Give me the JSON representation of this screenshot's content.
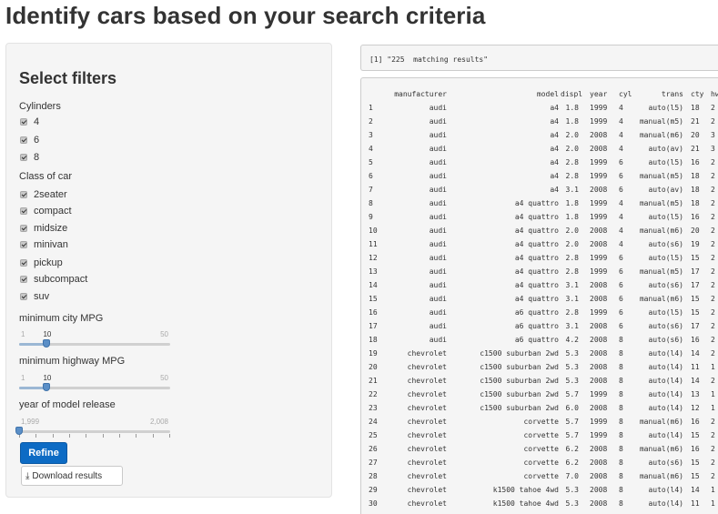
{
  "page": {
    "title": "Identify cars based on your search criteria"
  },
  "sidebar": {
    "heading": "Select filters",
    "cylinders": {
      "label": "Cylinders",
      "options": [
        {
          "label": "4",
          "checked": true
        },
        {
          "label": "6",
          "checked": true
        },
        {
          "label": "8",
          "checked": true
        }
      ]
    },
    "class": {
      "label": "Class of car",
      "options": [
        {
          "label": "2seater",
          "checked": true
        },
        {
          "label": "compact",
          "checked": true
        },
        {
          "label": "midsize",
          "checked": true
        },
        {
          "label": "minivan",
          "checked": true
        },
        {
          "label": "pickup",
          "checked": true
        },
        {
          "label": "subcompact",
          "checked": true
        },
        {
          "label": "suv",
          "checked": true
        }
      ]
    },
    "city_mpg": {
      "label": "minimum city MPG",
      "min": "1",
      "max": "50",
      "value_label": "10",
      "value": 10,
      "range": [
        1,
        50
      ]
    },
    "hwy_mpg": {
      "label": "minimum highway MPG",
      "min": "1",
      "max": "50",
      "value_label": "10",
      "value": 10,
      "range": [
        1,
        50
      ]
    },
    "year": {
      "label": "year of model release",
      "min": "1,999",
      "max": "2,008",
      "value": 1999,
      "range": [
        1999,
        2008
      ]
    },
    "refine_label": "Refine",
    "download_label": "Download results",
    "download_icon": "download-icon"
  },
  "output": {
    "count_text": "[1] \"225  matching results\"",
    "columns": [
      "",
      "manufacturer",
      "model",
      "displ",
      "year",
      "cyl",
      "trans",
      "cty",
      "hw"
    ],
    "rows": [
      [
        "1",
        "audi",
        "a4",
        "1.8",
        "1999",
        "4",
        "auto(l5)",
        "18",
        "2"
      ],
      [
        "2",
        "audi",
        "a4",
        "1.8",
        "1999",
        "4",
        "manual(m5)",
        "21",
        "2"
      ],
      [
        "3",
        "audi",
        "a4",
        "2.0",
        "2008",
        "4",
        "manual(m6)",
        "20",
        "3"
      ],
      [
        "4",
        "audi",
        "a4",
        "2.0",
        "2008",
        "4",
        "auto(av)",
        "21",
        "3"
      ],
      [
        "5",
        "audi",
        "a4",
        "2.8",
        "1999",
        "6",
        "auto(l5)",
        "16",
        "2"
      ],
      [
        "6",
        "audi",
        "a4",
        "2.8",
        "1999",
        "6",
        "manual(m5)",
        "18",
        "2"
      ],
      [
        "7",
        "audi",
        "a4",
        "3.1",
        "2008",
        "6",
        "auto(av)",
        "18",
        "2"
      ],
      [
        "8",
        "audi",
        "a4 quattro",
        "1.8",
        "1999",
        "4",
        "manual(m5)",
        "18",
        "2"
      ],
      [
        "9",
        "audi",
        "a4 quattro",
        "1.8",
        "1999",
        "4",
        "auto(l5)",
        "16",
        "2"
      ],
      [
        "10",
        "audi",
        "a4 quattro",
        "2.0",
        "2008",
        "4",
        "manual(m6)",
        "20",
        "2"
      ],
      [
        "11",
        "audi",
        "a4 quattro",
        "2.0",
        "2008",
        "4",
        "auto(s6)",
        "19",
        "2"
      ],
      [
        "12",
        "audi",
        "a4 quattro",
        "2.8",
        "1999",
        "6",
        "auto(l5)",
        "15",
        "2"
      ],
      [
        "13",
        "audi",
        "a4 quattro",
        "2.8",
        "1999",
        "6",
        "manual(m5)",
        "17",
        "2"
      ],
      [
        "14",
        "audi",
        "a4 quattro",
        "3.1",
        "2008",
        "6",
        "auto(s6)",
        "17",
        "2"
      ],
      [
        "15",
        "audi",
        "a4 quattro",
        "3.1",
        "2008",
        "6",
        "manual(m6)",
        "15",
        "2"
      ],
      [
        "16",
        "audi",
        "a6 quattro",
        "2.8",
        "1999",
        "6",
        "auto(l5)",
        "15",
        "2"
      ],
      [
        "17",
        "audi",
        "a6 quattro",
        "3.1",
        "2008",
        "6",
        "auto(s6)",
        "17",
        "2"
      ],
      [
        "18",
        "audi",
        "a6 quattro",
        "4.2",
        "2008",
        "8",
        "auto(s6)",
        "16",
        "2"
      ],
      [
        "19",
        "chevrolet",
        "c1500 suburban 2wd",
        "5.3",
        "2008",
        "8",
        "auto(l4)",
        "14",
        "2"
      ],
      [
        "20",
        "chevrolet",
        "c1500 suburban 2wd",
        "5.3",
        "2008",
        "8",
        "auto(l4)",
        "11",
        "1"
      ],
      [
        "21",
        "chevrolet",
        "c1500 suburban 2wd",
        "5.3",
        "2008",
        "8",
        "auto(l4)",
        "14",
        "2"
      ],
      [
        "22",
        "chevrolet",
        "c1500 suburban 2wd",
        "5.7",
        "1999",
        "8",
        "auto(l4)",
        "13",
        "1"
      ],
      [
        "23",
        "chevrolet",
        "c1500 suburban 2wd",
        "6.0",
        "2008",
        "8",
        "auto(l4)",
        "12",
        "1"
      ],
      [
        "24",
        "chevrolet",
        "corvette",
        "5.7",
        "1999",
        "8",
        "manual(m6)",
        "16",
        "2"
      ],
      [
        "25",
        "chevrolet",
        "corvette",
        "5.7",
        "1999",
        "8",
        "auto(l4)",
        "15",
        "2"
      ],
      [
        "26",
        "chevrolet",
        "corvette",
        "6.2",
        "2008",
        "8",
        "manual(m6)",
        "16",
        "2"
      ],
      [
        "27",
        "chevrolet",
        "corvette",
        "6.2",
        "2008",
        "8",
        "auto(s6)",
        "15",
        "2"
      ],
      [
        "28",
        "chevrolet",
        "corvette",
        "7.0",
        "2008",
        "8",
        "manual(m6)",
        "15",
        "2"
      ],
      [
        "29",
        "chevrolet",
        "k1500 tahoe 4wd",
        "5.3",
        "2008",
        "8",
        "auto(l4)",
        "14",
        "1"
      ],
      [
        "30",
        "chevrolet",
        "k1500 tahoe 4wd",
        "5.3",
        "2008",
        "8",
        "auto(l4)",
        "11",
        "1"
      ]
    ]
  }
}
